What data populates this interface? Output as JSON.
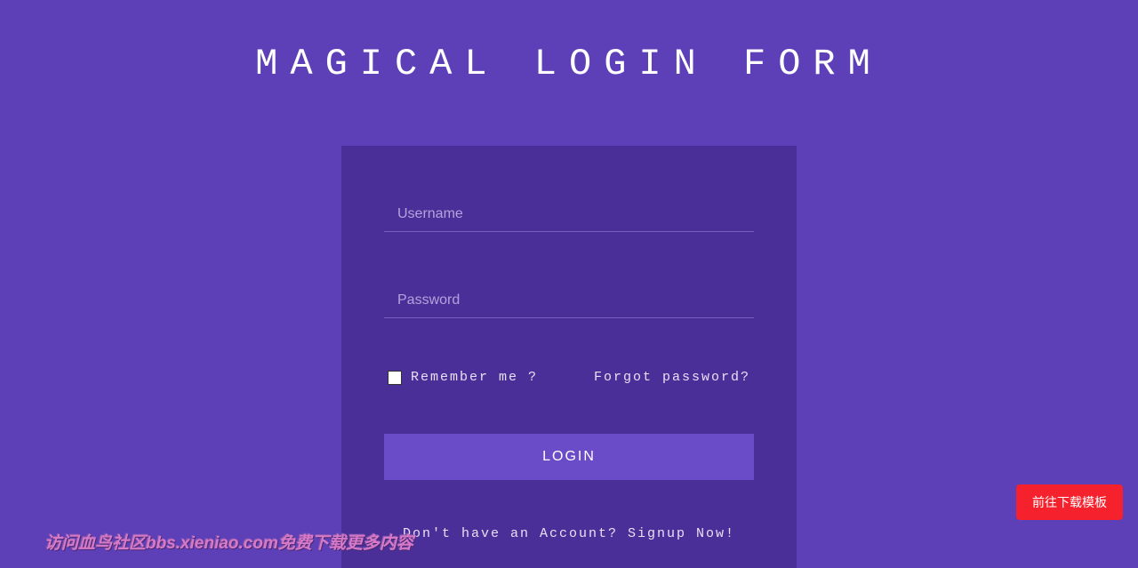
{
  "header": {
    "title": "MAGICAL LOGIN FORM"
  },
  "form": {
    "username": {
      "placeholder": "Username",
      "value": ""
    },
    "password": {
      "placeholder": "Password",
      "value": ""
    },
    "remember_label": "Remember me ?",
    "forgot_label": "Forgot password?",
    "login_button": "LOGIN",
    "signup_text": "Don't have an Account? Signup Now!"
  },
  "download_button": "前往下载模板",
  "watermark": "访问血鸟社区bbs.xieniao.com免费下载更多内容"
}
